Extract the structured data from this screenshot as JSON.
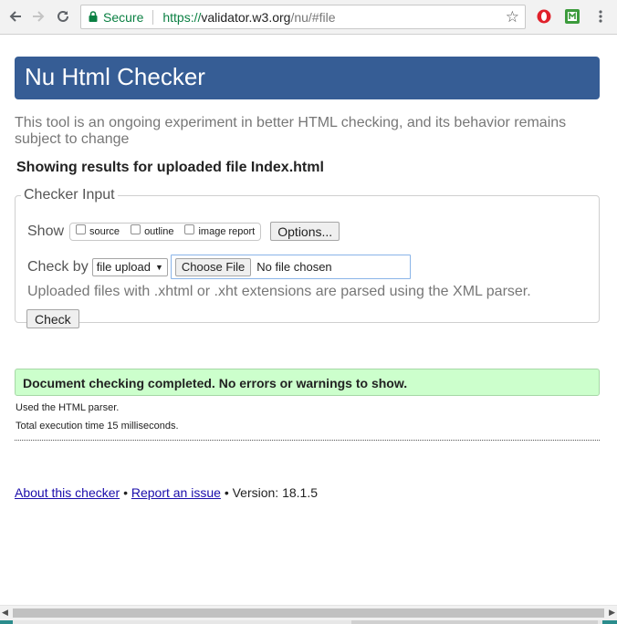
{
  "browser": {
    "secure_label": "Secure",
    "url_scheme": "https://",
    "url_host": "validator.w3.org",
    "url_path": "/nu/#file"
  },
  "page": {
    "title": "Nu Html Checker",
    "intro": "This tool is an ongoing experiment in better HTML checking, and its behavior remains subject to change",
    "showing": "Showing results for uploaded file Index.html",
    "checker_input": {
      "legend": "Checker Input",
      "show_label": "Show",
      "options": [
        "source",
        "outline",
        "image report"
      ],
      "options_button": "Options...",
      "check_by_label": "Check by",
      "check_by_value": "file upload",
      "choose_file_button": "Choose File",
      "no_file": "No file chosen",
      "note": "Uploaded files with .xhtml or .xht extensions are parsed using the XML parser.",
      "check_button": "Check"
    },
    "result": {
      "message": "Document checking completed. No errors or warnings to show.",
      "parser": "Used the HTML parser.",
      "time": "Total execution time 15 milliseconds."
    },
    "footer": {
      "about": "About this checker",
      "sep1": "•",
      "report": "Report an issue",
      "sep2": "•",
      "version": "Version: 18.1.5"
    }
  },
  "colors": {
    "banner": "#365d95",
    "success_bg": "#ccffcc",
    "secure_green": "#0b8043",
    "link": "#1a0dab"
  },
  "icons": [
    "back-arrow-icon",
    "forward-arrow-icon",
    "reload-icon",
    "lock-icon",
    "star-icon",
    "opera-extension-icon",
    "green-extension-icon",
    "menu-dots-icon"
  ]
}
